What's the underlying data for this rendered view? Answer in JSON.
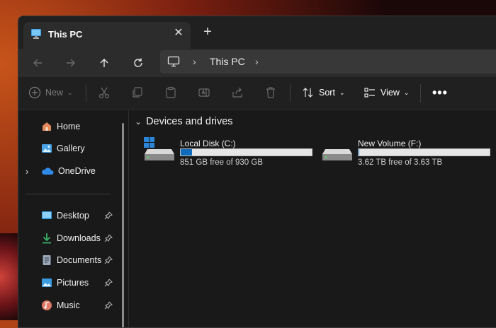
{
  "tab": {
    "title": "This PC"
  },
  "address": {
    "segment": "This PC"
  },
  "toolbar": {
    "new_label": "New",
    "sort_label": "Sort",
    "view_label": "View"
  },
  "sidebar": {
    "top_items": [
      {
        "label": "Home"
      },
      {
        "label": "Gallery"
      },
      {
        "label": "OneDrive"
      }
    ],
    "pinned_items": [
      {
        "label": "Desktop"
      },
      {
        "label": "Downloads"
      },
      {
        "label": "Documents"
      },
      {
        "label": "Pictures"
      },
      {
        "label": "Music"
      }
    ]
  },
  "content": {
    "section_title": "Devices and drives",
    "drives": [
      {
        "name": "Local Disk (C:)",
        "free_text": "851 GB free of 930 GB",
        "used_fraction": 0.085,
        "fill_color": "#0f6cbd"
      },
      {
        "name": "New Volume (F:)",
        "free_text": "3.62 TB free of 3.63 TB",
        "used_fraction": 0.003,
        "fill_color": "#0f6cbd"
      }
    ]
  },
  "colors": {
    "accent": "#0f6cbd",
    "window_bg": "#191919",
    "toolbar_bg": "#202020"
  }
}
